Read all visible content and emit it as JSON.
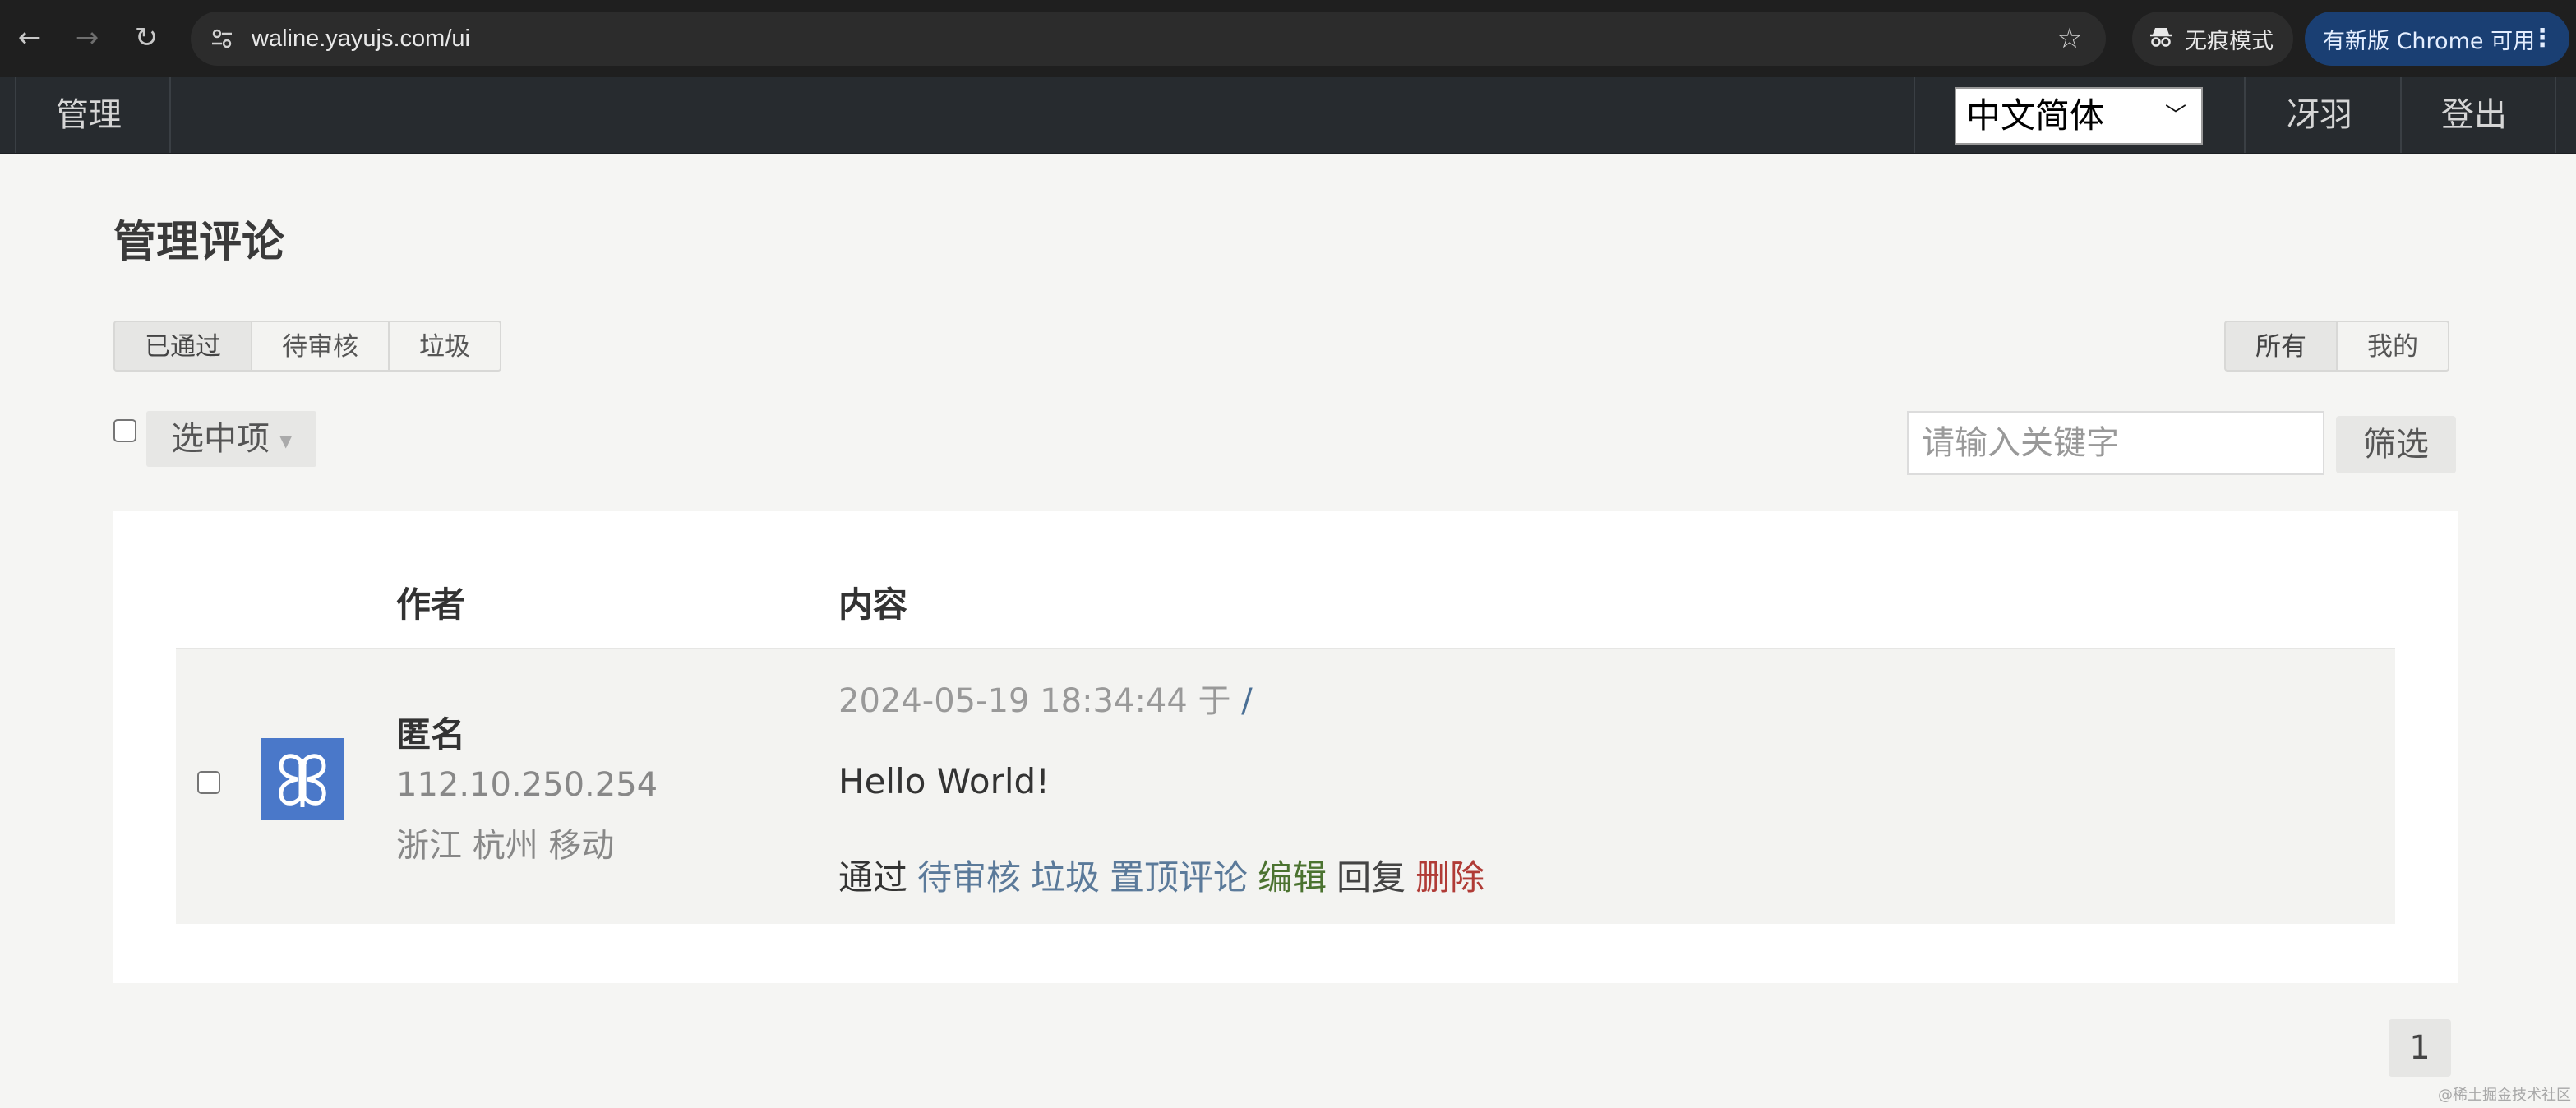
{
  "browser": {
    "url": "waline.yayujs.com/ui",
    "incognito_label": "无痕模式",
    "update_label": "有新版 Chrome 可用"
  },
  "navbar": {
    "brand": "管理",
    "language": "中文简体",
    "user": "冴羽",
    "logout": "登出"
  },
  "page": {
    "title": "管理评论",
    "status_tabs": [
      "已通过",
      "待审核",
      "垃圾"
    ],
    "scope_tabs": [
      "所有",
      "我的"
    ],
    "bulk_menu_label": "选中项",
    "search_placeholder": "请输入关键字",
    "filter_label": "筛选"
  },
  "table": {
    "headers": {
      "author": "作者",
      "content": "内容"
    },
    "rows": [
      {
        "author_name": "匿名",
        "ip": "112.10.250.254",
        "location": "浙江 杭州 移动",
        "time": "2024-05-19 18:34:44",
        "at_label": "于",
        "path": "/",
        "comment": "Hello World!",
        "actions": {
          "approve": "通过",
          "pending": "待审核",
          "spam": "垃圾",
          "sticky": "置顶评论",
          "edit": "编辑",
          "reply": "回复",
          "delete": "删除"
        }
      }
    ]
  },
  "pagination": {
    "current": "1"
  },
  "watermark": "@稀土掘金技术社区",
  "colors": {
    "navbar_bg": "#272b2f",
    "page_bg": "#f5f5f3",
    "link_blue": "#5b7a9a",
    "link_green": "#4b7330",
    "link_red": "#b03b36",
    "avatar_bg": "#4a78c9"
  },
  "icons": [
    "back-arrow-icon",
    "forward-arrow-icon",
    "reload-icon",
    "site-settings-icon",
    "bookmark-star-icon",
    "incognito-icon",
    "kebab-menu-icon",
    "chevron-down-icon",
    "caret-down-icon",
    "avatar-logo-icon"
  ]
}
